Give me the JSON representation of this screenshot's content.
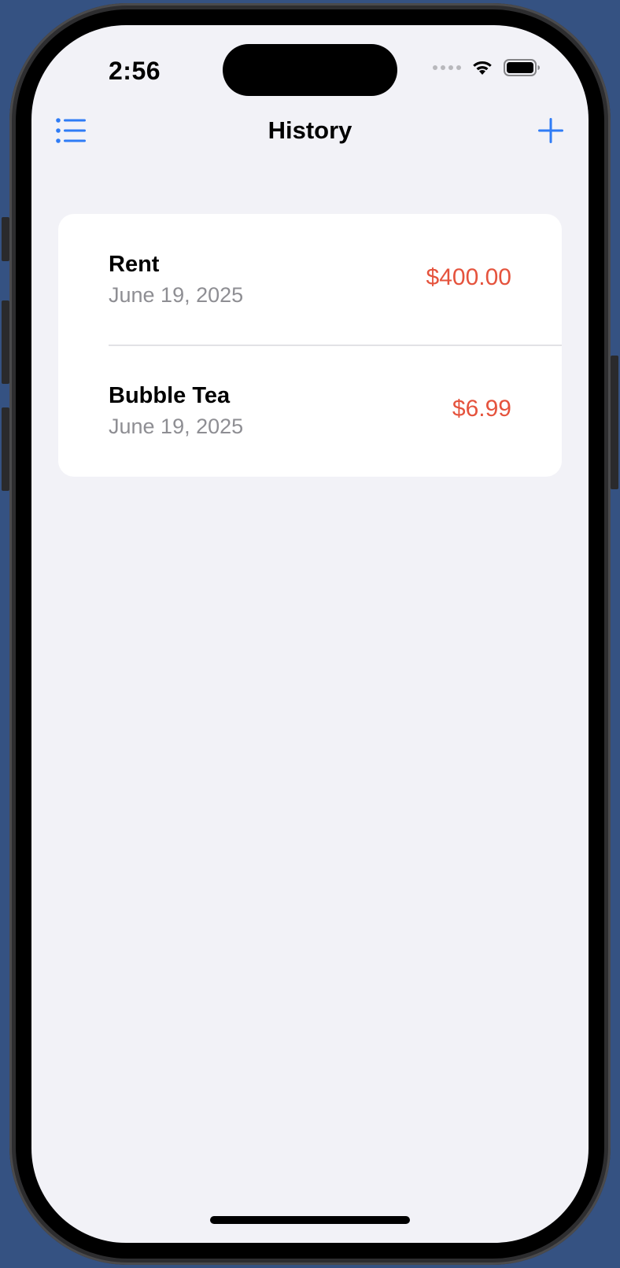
{
  "status_bar": {
    "time": "2:56"
  },
  "nav": {
    "title": "History",
    "left_icon": "list-bullet-icon",
    "right_icon": "plus-icon"
  },
  "transactions": [
    {
      "title": "Rent",
      "date": "June 19, 2025",
      "amount": "$400.00"
    },
    {
      "title": "Bubble Tea",
      "date": "June 19, 2025",
      "amount": "$6.99"
    }
  ],
  "colors": {
    "accent": "#2f7cf6",
    "expense": "#e5533d",
    "background": "#f2f2f7",
    "secondary_text": "#8e8e93"
  }
}
